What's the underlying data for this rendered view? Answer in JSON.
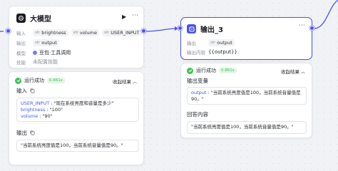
{
  "llm_node": {
    "title": "大模型",
    "input_label": "输入",
    "inputs": [
      {
        "type": "str",
        "name": "brightness"
      },
      {
        "type": "str",
        "name": "volume"
      },
      {
        "type": "str",
        "name": "USER_INPUT"
      }
    ],
    "output_label": "输出",
    "outputs": [
      {
        "type": "str",
        "name": "output"
      }
    ],
    "model_label": "模型",
    "model_value": "豆包·工具调用",
    "skill_label": "技能",
    "skill_value": "未配置技能",
    "result": {
      "status": "运行成功",
      "time": "0.861s",
      "collapse": "收起结果",
      "input_title": "输入",
      "input_lines": [
        {
          "key": "USER_INPUT",
          "value": "\"现在系统亮度和音量是多少\""
        },
        {
          "key": "brightness",
          "value": "\"100\""
        },
        {
          "key": "volume",
          "value": "\"90\""
        }
      ],
      "output_title": "输出",
      "output_text": "\"当前系统亮度值是100，当前系统音量值是90。\""
    }
  },
  "output_node": {
    "title": "输出_3",
    "output_label": "输出",
    "outputs": [
      {
        "type": "str",
        "name": "output"
      }
    ],
    "content_label": "输出内容",
    "content_value": "{{output}}",
    "result": {
      "status": "运行成功",
      "time": "0.861s",
      "collapse": "收起结果",
      "var_title": "输出变量",
      "var_key": "output",
      "var_value": "\"当前系统亮度值是100，当前系统音量值是90。\"",
      "reply_title": "回答内容",
      "reply_text": "\"当前系统亮度值是100，当前系统音量值是90。\""
    }
  },
  "colors": {
    "accent": "#4d53e8",
    "success": "#3ec254"
  }
}
